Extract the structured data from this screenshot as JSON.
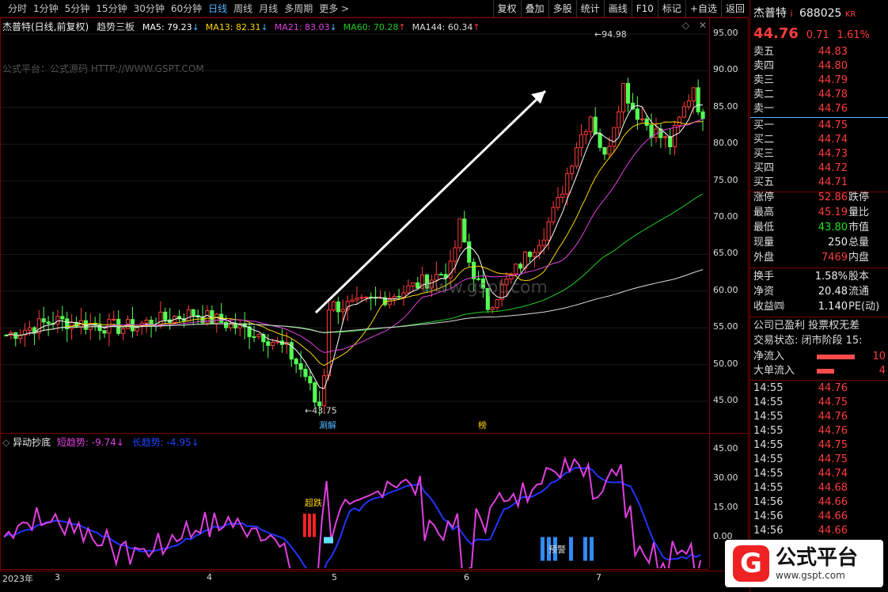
{
  "toolbar": {
    "tabs": [
      "分时",
      "1分钟",
      "5分钟",
      "15分钟",
      "30分钟",
      "60分钟",
      "日线",
      "周线",
      "月线",
      "多周期",
      "更多 >"
    ],
    "active": "日线",
    "tools": [
      "复权",
      "叠加",
      "多股",
      "统计",
      "画线",
      "F10",
      "标记",
      "+自选",
      "返回"
    ]
  },
  "chart": {
    "title": "杰普特(日线,前复权)",
    "indicator": "趋势三板",
    "ma": [
      {
        "label": "MA5: 79.23",
        "arrow": "↓",
        "color": "#ffffff"
      },
      {
        "label": "MA13: 82.31",
        "arrow": "↓",
        "color": "#ffd400"
      },
      {
        "label": "MA21: 83.03",
        "arrow": "↓",
        "color": "#e040e0"
      },
      {
        "label": "MA60: 70.28",
        "arrow": "↑",
        "color": "#22cc22"
      },
      {
        "label": "MA144: 60.34",
        "arrow": "↑",
        "color": "#dddddd"
      }
    ],
    "watermark_top": "公式平台：公式源码 HTTP://WWW.GSPT.COM",
    "watermark_mid": "www.gspt.com",
    "high_label": "94.98",
    "low_label": "43.75",
    "price_axis": [
      "95.00",
      "90.00",
      "85.00",
      "80.00",
      "75.00",
      "70.00",
      "65.00",
      "60.00",
      "55.00",
      "50.00",
      "45.00"
    ],
    "markers": {
      "m1": "涮解",
      "m2": "榜"
    },
    "sub_title": "异动抄底",
    "sub_short": "短趋势: -9.74",
    "sub_short_arrow": "↓",
    "sub_long": "长趋势: -4.95",
    "sub_long_arrow": "↓",
    "sub_axis": [
      "45.00",
      "30.00",
      "15.00",
      "0.00"
    ],
    "sub_labels": {
      "chaodie": "超跌",
      "yujing": "预警"
    },
    "date_axis": [
      "2023年",
      "3",
      "4",
      "5",
      "6",
      "7"
    ]
  },
  "quote": {
    "name": "杰普特",
    "flag": "i",
    "code": "688025",
    "kr": "KR",
    "price": "44.76",
    "change": "0.71",
    "pct": "1.61%",
    "asks": [
      {
        "k": "卖五",
        "v": "44.83"
      },
      {
        "k": "卖四",
        "v": "44.80"
      },
      {
        "k": "卖三",
        "v": "44.79"
      },
      {
        "k": "卖二",
        "v": "44.78"
      },
      {
        "k": "卖一",
        "v": "44.76"
      }
    ],
    "bids": [
      {
        "k": "买一",
        "v": "44.75"
      },
      {
        "k": "买二",
        "v": "44.74"
      },
      {
        "k": "买三",
        "v": "44.73"
      },
      {
        "k": "买四",
        "v": "44.72"
      },
      {
        "k": "买五",
        "v": "44.71"
      }
    ],
    "stats": [
      {
        "k": "涨停",
        "v": "52.86",
        "c": "red",
        "k2": "跌停"
      },
      {
        "k": "最高",
        "v": "45.19",
        "c": "red",
        "k2": "量比"
      },
      {
        "k": "最低",
        "v": "43.80",
        "c": "green",
        "k2": "市值"
      },
      {
        "k": "现量",
        "v": "250",
        "c": "white",
        "k2": "总量"
      },
      {
        "k": "外盘",
        "v": "7469",
        "c": "red",
        "k2": "内盘"
      }
    ],
    "stats2": [
      {
        "k": "换手",
        "v": "1.58%",
        "c": "white",
        "k2": "股本"
      },
      {
        "k": "净资",
        "v": "20.48",
        "c": "white",
        "k2": "流通"
      },
      {
        "k": "收益㈣",
        "v": "1.140",
        "c": "white",
        "k2": "PE(动)"
      }
    ],
    "notice": "公司已盈利 投票权无差",
    "status": "交易状态: 闭市阶段 15:",
    "flow": [
      {
        "k": "净流入",
        "v": "10"
      },
      {
        "k": "大单流入",
        "v": "4"
      }
    ],
    "ticks": [
      {
        "t": "14:55",
        "p": "44.76"
      },
      {
        "t": "14:55",
        "p": "44.75"
      },
      {
        "t": "14:55",
        "p": "44.76"
      },
      {
        "t": "14:55",
        "p": "44.76"
      },
      {
        "t": "14:55",
        "p": "44.75"
      },
      {
        "t": "14:55",
        "p": "44.75"
      },
      {
        "t": "14:55",
        "p": "44.74"
      },
      {
        "t": "14:55",
        "p": "44.68"
      },
      {
        "t": "14:56",
        "p": "44.66"
      },
      {
        "t": "14:56",
        "p": "44.66"
      },
      {
        "t": "14:56",
        "p": "44.66"
      }
    ]
  },
  "logo": {
    "glyph": "G",
    "name": "公式平台",
    "url": "www.gspt.com"
  }
}
